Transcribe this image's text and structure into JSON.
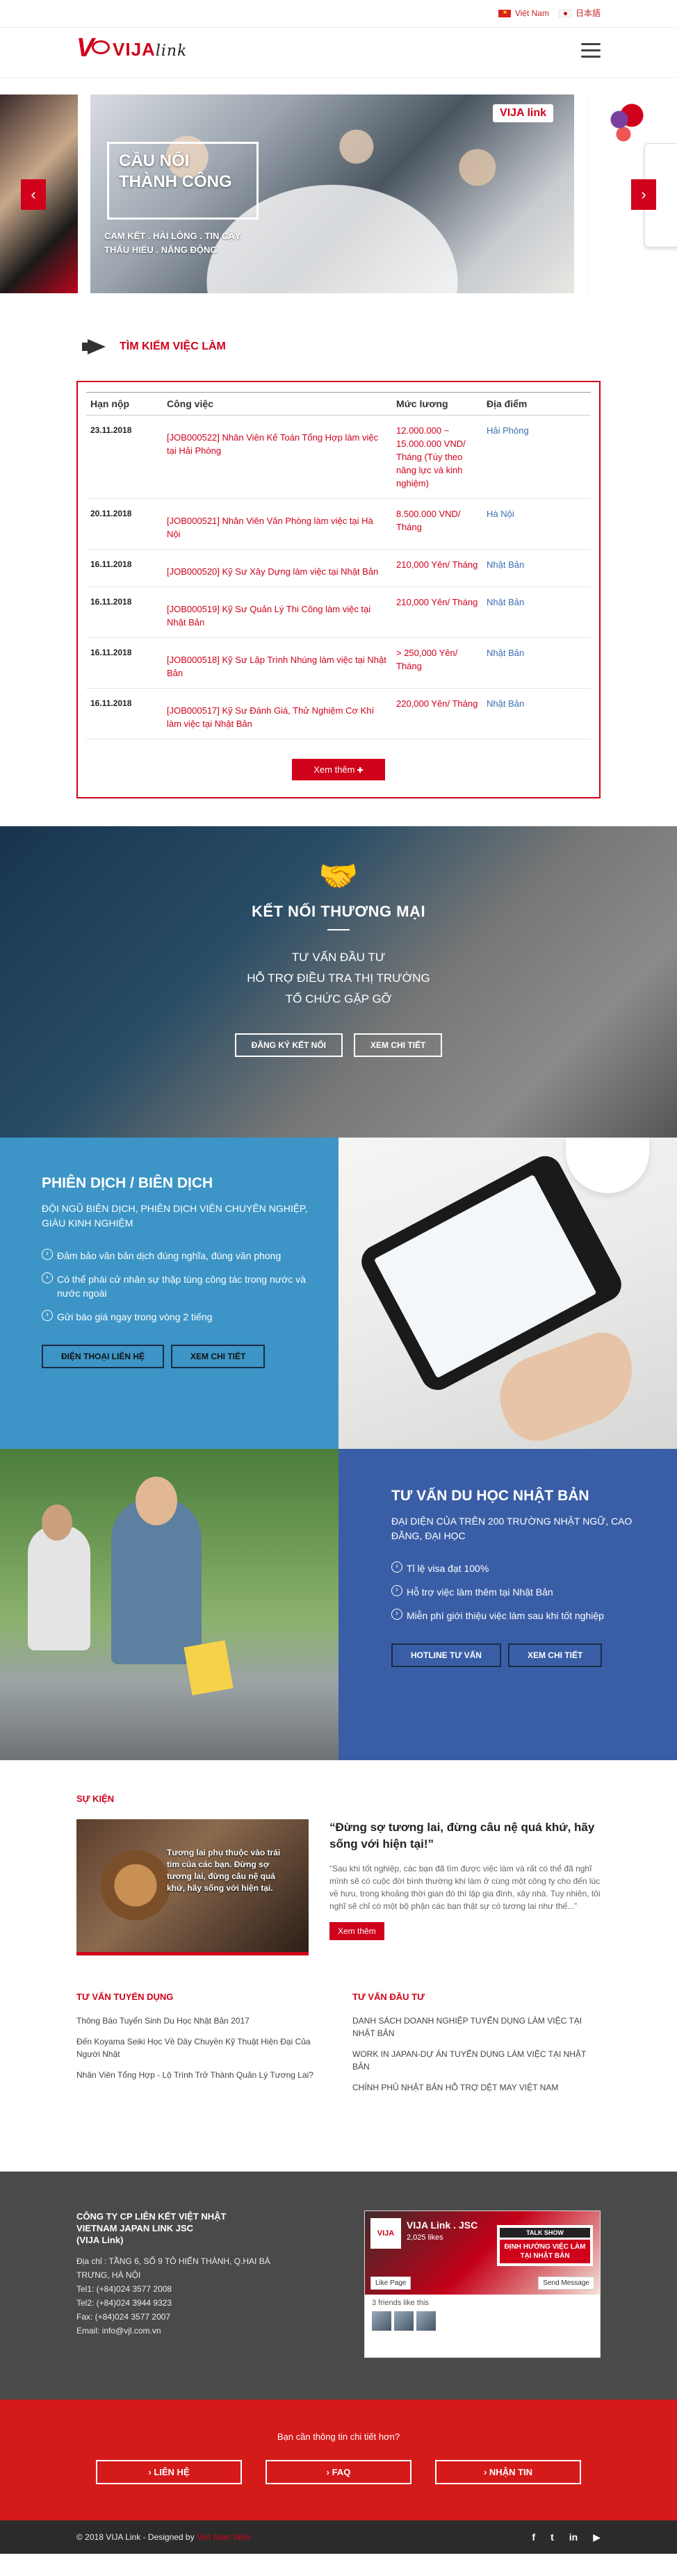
{
  "topbar": {
    "languages": [
      {
        "label": "Việt Nam"
      },
      {
        "label": "日本語"
      }
    ]
  },
  "header": {
    "logo_main": "VIJA",
    "logo_sub": "link"
  },
  "slider": {
    "headline_line1": "CẦU NỐI",
    "headline_line2": "THÀNH CÔNG",
    "tagline_line1": "CAM KẾT . HÀI LÒNG . TIN CẬY",
    "tagline_line2": "THẤU HIỂU . NĂNG ĐỘNG",
    "slide_logo": "VIJA link",
    "prev": "‹",
    "next": "›"
  },
  "jobs": {
    "title": "TÌM KIẾM VIỆC LÀM",
    "columns": [
      "Hạn nộp",
      "Công việc",
      "Mức lương",
      "Địa điểm"
    ],
    "rows": [
      {
        "date": "23.11.2018",
        "job": "[JOB000522] Nhân Viên Kế Toán Tổng Hợp làm việc tại Hải Phòng",
        "salary": "12.000.000 ~ 15.000.000 VND/ Tháng (Tùy theo năng lực và kinh nghiệm)",
        "location": "Hải Phòng"
      },
      {
        "date": "20.11.2018",
        "job": "[JOB000521] Nhân Viên Văn Phòng làm việc tại Hà Nội",
        "salary": "8.500.000 VND/ Tháng",
        "location": "Hà Nội"
      },
      {
        "date": "16.11.2018",
        "job": "[JOB000520] Kỹ Sư Xây Dựng làm việc tại Nhật Bản",
        "salary": "210,000 Yên/ Tháng",
        "location": "Nhật Bản"
      },
      {
        "date": "16.11.2018",
        "job": "[JOB000519] Kỹ Sư Quản Lý Thi Công làm việc tại Nhật Bản",
        "salary": "210,000 Yên/ Tháng",
        "location": "Nhật Bản"
      },
      {
        "date": "16.11.2018",
        "job": "[JOB000518] Kỹ Sư Lập Trình Nhúng làm việc tại Nhật Bản",
        "salary": "> 250,000 Yên/ Tháng",
        "location": "Nhật Bản"
      },
      {
        "date": "16.11.2018",
        "job": "[JOB000517] Kỹ Sư Đánh Giá, Thử Nghiệm Cơ Khí làm việc tại Nhật Bản",
        "salary": "220,000 Yên/ Tháng",
        "location": "Nhật Bản"
      }
    ],
    "more_label": "Xem thêm"
  },
  "ketnoi": {
    "title": "KẾT NỐI THƯƠNG MẠI",
    "line1": "TƯ VẤN ĐẦU TƯ",
    "line2": "HỖ TRỢ ĐIỀU TRA THỊ TRƯỜNG",
    "line3": "TỔ CHỨC GẶP GỠ",
    "btn1": "ĐĂNG KÝ KẾT NỐI",
    "btn2": "XEM CHI TIẾT"
  },
  "phiendich": {
    "title": "PHIÊN DỊCH / BIÊN DỊCH",
    "sub": "ĐỘI NGŨ BIÊN DỊCH, PHIÊN DỊCH VIÊN CHUYÊN NGHIỆP, GIÀU KINH NGHIỆM",
    "items": [
      "Đảm bảo văn bản dịch đúng nghĩa, đúng văn phong",
      "Có thể phái cử nhân sự thập tùng công tác trong nước và nước ngoài",
      "Gửi báo giá ngay trong vòng 2 tiếng"
    ],
    "btn1": "ĐIỆN THOẠI LIÊN HỆ",
    "btn2": "XEM CHI TIẾT"
  },
  "duhoc": {
    "title": "TƯ VẤN DU HỌC NHẬT BẢN",
    "sub": "ĐẠI DIỆN CỦA TRÊN 200 TRƯỜNG NHẬT NGỮ, CAO ĐẲNG, ĐẠI HỌC",
    "items": [
      "Tỉ lệ visa đạt 100%",
      "Hỗ trợ việc làm thêm tại Nhật Bản",
      "Miễn phí giới thiệu việc làm sau khi tốt nghiệp"
    ],
    "btn1": "HOTLINE TƯ VẤN",
    "btn2": "XEM CHI TIẾT"
  },
  "events": {
    "title": "SỰ KIỆN",
    "image_caption": "Tương lai phụ thuộc vào trái tim của các bạn. Đừng sợ tương lai, đừng câu nệ quá khứ, hãy sống với hiện tại.",
    "quote": "“Đừng sợ tương lai, đừng câu nệ quá khứ, hãy sống với hiện tại!”",
    "body": "“Sau khi tốt nghiệp, các bạn đã tìm được việc làm và rất có thể đã nghĩ mình sẽ có cuộc đời bình thường khi làm ở cùng một công ty cho đến lúc về hưu, trong khoảng thời gian đó thì lập gia đình, xây nhà. Tuy nhiên, tôi nghĩ sẽ chỉ có một bộ phận các bạn thật sự có tương lai như thế...”",
    "btn": "Xem thêm"
  },
  "lists": {
    "recruit_title": "TƯ VẤN TUYỂN DỤNG",
    "recruit": [
      "Thông Báo Tuyển Sinh Du Học Nhật Bản 2017",
      "Đến Koyama Seiki Học Về Dây Chuyền Kỹ Thuật Hiện Đại Của Người Nhật",
      "Nhân Viên Tổng Hợp - Lộ Trình Trở Thành Quản Lý Tương Lai?"
    ],
    "invest_title": "TƯ VẤN ĐẦU TƯ",
    "invest": [
      "DANH SÁCH DOANH NGHIỆP TUYỂN DỤNG LÀM VIỆC TẠI NHẬT BẢN",
      "WORK IN JAPAN-DỰ ÁN TUYỂN DỤNG LÀM VIỆC TẠI NHẬT BẢN",
      "CHÍNH PHỦ NHẬT BẢN HỖ TRỢ DỆT MAY VIỆT NAM"
    ]
  },
  "footer": {
    "company_line1": "CÔNG TY CP LIÊN KẾT VIỆT NHẬT",
    "company_line2": "VIETNAM JAPAN LINK JSC",
    "company_line3": "(VIJA Link)",
    "address": "Địa chỉ : TẦNG 6, SỐ 9 TÔ HIẾN THÀNH, Q.HAI BÀ TRƯNG, HÀ NỘI",
    "tel1": "Tel1: (+84)024 3577 2008",
    "tel2": "Tel2: (+84)024 3944 9323",
    "fax": "Fax: (+84)024 3577 2007",
    "email": "Email: info@vjl.com.vn",
    "fb_name": "VIJA Link . JSC",
    "fb_likes": "2,025 likes",
    "fb_avatar": "VIJA",
    "fb_talk_title": "TALK SHOW",
    "fb_talk_body": "ĐỊNH HƯỚNG VIỆC LÀM TẠI NHẬT BẢN",
    "fb_like": "Like Page",
    "fb_message": "Send Message",
    "fb_friends": "3 friends like this"
  },
  "cta": {
    "question": "Bạn cần thông tin chi tiết hơn?",
    "btn1": "LIÊN HỆ",
    "btn2": "FAQ",
    "btn3": "NHẬN TIN"
  },
  "copyright": {
    "text": "© 2018 VIJA Link - Designed by",
    "designer": "Viet Nam Web",
    "social": [
      "f",
      "t",
      "in",
      "▶"
    ]
  }
}
